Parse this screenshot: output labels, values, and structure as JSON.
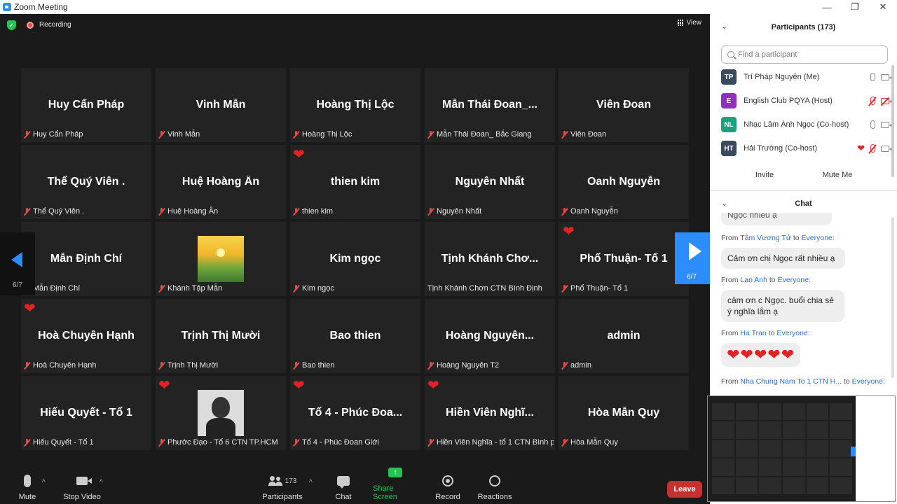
{
  "window": {
    "title": "Zoom Meeting"
  },
  "topbar": {
    "recording": "Recording",
    "view": "View"
  },
  "tiles": [
    {
      "big": "Huy Cẩn Pháp",
      "label": "Huy Cẩn Pháp"
    },
    {
      "big": "Vinh Mẫn",
      "label": "Vinh Mẫn"
    },
    {
      "big": "Hoàng Thị Lộc",
      "label": "Hoàng Thị Lộc"
    },
    {
      "big": "Mẫn Thái Đoan_...",
      "label": "Mẫn Thái Đoan_ Bắc Giang"
    },
    {
      "big": "Viên Đoan",
      "label": "Viên Đoan"
    },
    {
      "big": "Thể Quý Viên .",
      "label": "Thể Quý Viên ."
    },
    {
      "big": "Huệ Hoàng Ân",
      "label": "Huệ Hoàng Ân"
    },
    {
      "big": "thien kim",
      "label": "thien kim"
    },
    {
      "big": "Nguyên Nhất",
      "label": "Nguyên Nhất"
    },
    {
      "big": "Oanh Nguyễn",
      "label": "Oanh Nguyễn"
    },
    {
      "big": "Mẫn Định Chí",
      "label": "Mẫn Định Chí"
    },
    {
      "big": "",
      "label": "Khánh Tập Mẫn"
    },
    {
      "big": "Kim ngọc",
      "label": "Kim ngọc"
    },
    {
      "big": "Tịnh Khánh Chơ...",
      "label": "Tịnh Khánh Chơn CTN Bình Định"
    },
    {
      "big": "Phổ Thuận- Tổ 1",
      "label": "Phổ Thuận- Tổ 1"
    },
    {
      "big": "Hoà Chuyên Hạnh",
      "label": "Hoà Chuyên Hạnh"
    },
    {
      "big": "Trịnh Thị Mười",
      "label": "Trịnh Thị Mười"
    },
    {
      "big": "Bao thien",
      "label": "Bao thien"
    },
    {
      "big": "Hoàng Nguyên...",
      "label": "Hoàng Nguyên T2"
    },
    {
      "big": "admin",
      "label": "admin"
    },
    {
      "big": "Hiếu Quyết - Tổ 1",
      "label": "Hiếu Quyết - Tổ 1"
    },
    {
      "big": "",
      "label": "Phước Đạo - Tổ 6 CTN TP.HCM"
    },
    {
      "big": "Tổ 4 - Phúc Đoa...",
      "label": "Tổ 4 - Phúc Đoan Giới"
    },
    {
      "big": "Hiền Viên Nghĩ...",
      "label": "Hiền Viên Nghĩa - tổ 1 CTN Bình p..."
    },
    {
      "big": "Hòa Mẫn Quy",
      "label": "Hòa Mẫn Quy"
    }
  ],
  "pager": {
    "left": "6/7",
    "right": "6/7"
  },
  "toolbar": {
    "mute": "Mute",
    "stop_video": "Stop Video",
    "participants": "Participants",
    "participants_count": "173",
    "chat": "Chat",
    "share_screen": "Share Screen",
    "record": "Record",
    "reactions": "Reactions",
    "leave": "Leave"
  },
  "participants_panel": {
    "title": "Participants (173)",
    "search_placeholder": "Find a participant",
    "list": [
      {
        "initials": "TP",
        "name": "Trí Pháp Nguyện (Me)",
        "color": "#3a4a5e"
      },
      {
        "initials": "E",
        "name": "English Club PQYA (Host)",
        "color": "#8e2fbf"
      },
      {
        "initials": "NL",
        "name": "Nhạc Lâm Ánh Ngọc (Co-host)",
        "color": "#1aa37a"
      },
      {
        "initials": "HT",
        "name": "Hải Trường (Co-host)",
        "color": "#3a4a5e"
      }
    ],
    "invite": "Invite",
    "mute_me": "Mute Me"
  },
  "chat_panel": {
    "title": "Chat",
    "partial": "Ngọc nhiều ạ",
    "messages": [
      {
        "from_prefix": "From",
        "from": "Tâm Vương Tử",
        "to_prefix": "to",
        "to": "Everyone:",
        "text": "Cảm ơn chị Ngọc rất nhiều ạ"
      },
      {
        "from_prefix": "From",
        "from": "Lan Anh",
        "to_prefix": "to",
        "to": "Everyone:",
        "text": "cảm ơn c Ngọc. buổi chia sẻ ý nghĩa lắm ạ"
      },
      {
        "from_prefix": "From",
        "from": "Ha Tran",
        "to_prefix": "to",
        "to": "Everyone:",
        "text": "❤❤❤❤❤"
      },
      {
        "from_prefix": "From",
        "from": "Nha Chung Nam To 1 CTN H...",
        "to_prefix": "to",
        "to": "Everyone:",
        "text": ""
      }
    ]
  },
  "colors": {
    "accent": "#2D8CFF",
    "share": "#23c552",
    "leave": "#c53030",
    "muted": "#e84a4a"
  },
  "icons": {
    "heart": "❤",
    "chevron": "⌄",
    "caret": "^",
    "minimize": "—",
    "restore": "❐",
    "close": "✕"
  }
}
